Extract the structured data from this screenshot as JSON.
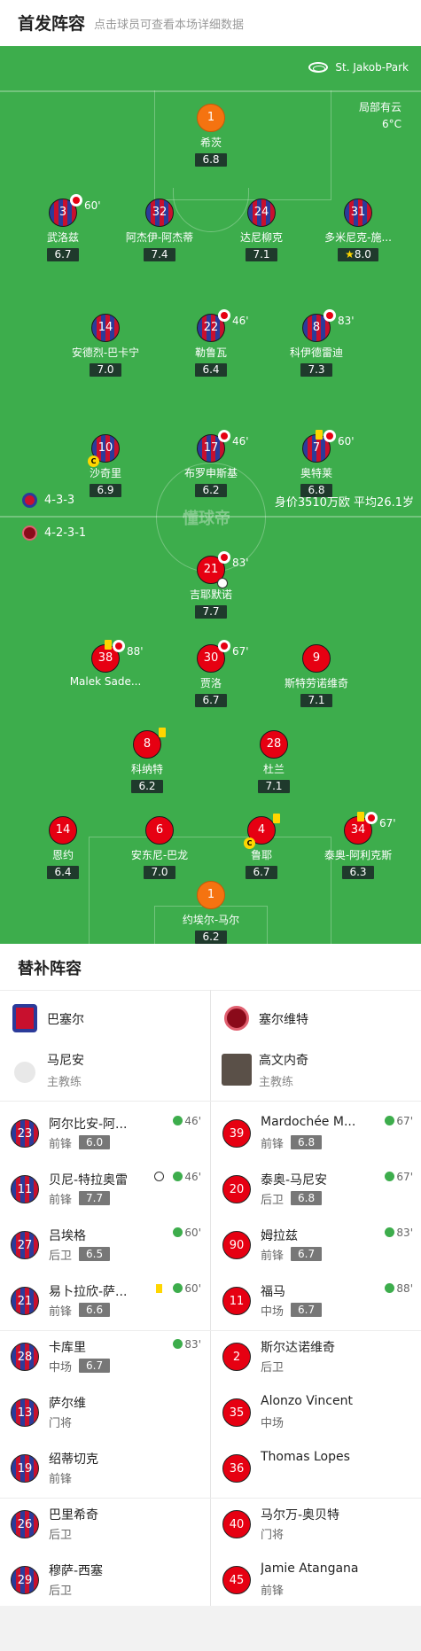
{
  "header": {
    "title": "首发阵容",
    "subtitle": "点击球员可查看本场详细数据"
  },
  "venue": {
    "name": "St. Jakob-Park",
    "icon": "stadium-icon"
  },
  "weather": {
    "condition": "局部有云",
    "temp": "6°C"
  },
  "watermark": "懂球帝",
  "home": {
    "formation": "4-3-3",
    "club": "巴塞尔",
    "coach": "马尼安",
    "coach_role": "主教练",
    "color": "#2b3b9a"
  },
  "away": {
    "formation": "4-2-3-1",
    "club": "塞尔维特",
    "coach": "高文内奇",
    "coach_role": "主教练",
    "color": "#e60012"
  },
  "market_value": "身价3510万欧 平均26.1岁",
  "home_players": [
    {
      "num": "1",
      "name": "希茨",
      "rating": "6.8",
      "gk": true
    },
    {
      "num": "3",
      "name": "武洛兹",
      "rating": "6.7",
      "sub": "60'"
    },
    {
      "num": "32",
      "name": "阿杰伊-阿杰蒂",
      "rating": "7.4"
    },
    {
      "num": "24",
      "name": "达尼柳克",
      "rating": "7.1"
    },
    {
      "num": "31",
      "name": "多米尼克-施...",
      "rating": "8.0",
      "star": true
    },
    {
      "num": "14",
      "name": "安德烈-巴卡宁",
      "rating": "7.0"
    },
    {
      "num": "22",
      "name": "勒鲁瓦",
      "rating": "6.4",
      "sub": "46'"
    },
    {
      "num": "8",
      "name": "科伊德雷迪",
      "rating": "7.3",
      "sub": "83'"
    },
    {
      "num": "10",
      "name": "沙奇里",
      "rating": "6.9",
      "captain": "C"
    },
    {
      "num": "17",
      "name": "布罗申斯基",
      "rating": "6.2",
      "sub": "46'"
    },
    {
      "num": "7",
      "name": "奥特莱",
      "rating": "6.8",
      "sub": "60'",
      "yellow": true
    }
  ],
  "away_players": [
    {
      "num": "21",
      "name": "吉耶默诺",
      "rating": "7.7",
      "sub": "83'",
      "goal": true
    },
    {
      "num": "38",
      "name": "Malek Sade...",
      "rating": "",
      "sub": "88'",
      "yellow": true
    },
    {
      "num": "30",
      "name": "贾洛",
      "rating": "6.7",
      "sub": "67'"
    },
    {
      "num": "9",
      "name": "斯特劳诺维奇",
      "rating": "7.1"
    },
    {
      "num": "8",
      "name": "科纳特",
      "rating": "6.2",
      "yellow": true
    },
    {
      "num": "28",
      "name": "杜兰",
      "rating": "7.1"
    },
    {
      "num": "14",
      "name": "恩约",
      "rating": "6.4"
    },
    {
      "num": "6",
      "name": "安东尼-巴龙",
      "rating": "7.0"
    },
    {
      "num": "4",
      "name": "鲁耶",
      "rating": "6.7",
      "captain": "C",
      "yellow": true
    },
    {
      "num": "34",
      "name": "泰奥-阿利克斯",
      "rating": "6.3",
      "sub": "67'",
      "yellow": true
    },
    {
      "num": "1",
      "name": "约埃尔-马尔",
      "rating": "6.2",
      "gk": true
    }
  ],
  "subs_title": "替补阵容",
  "home_subs": [
    {
      "num": "23",
      "name": "阿尔比安-阿...",
      "pos": "前锋",
      "rating": "6.0",
      "min": "46'"
    },
    {
      "num": "11",
      "name": "贝尼-特拉奥雷",
      "pos": "前锋",
      "rating": "7.7",
      "min": "46'",
      "goal": true
    },
    {
      "num": "27",
      "name": "吕埃格",
      "pos": "后卫",
      "rating": "6.5",
      "min": "60'"
    },
    {
      "num": "21",
      "name": "易卜拉欣-萨...",
      "pos": "前锋",
      "rating": "6.6",
      "min": "60'",
      "yellow": true
    },
    {
      "num": "28",
      "name": "卡库里",
      "pos": "中场",
      "rating": "6.7",
      "min": "83'"
    },
    {
      "num": "13",
      "name": "萨尔维",
      "pos": "门将"
    },
    {
      "num": "19",
      "name": "绍蒂切克",
      "pos": "前锋"
    },
    {
      "num": "26",
      "name": "巴里希奇",
      "pos": "后卫"
    },
    {
      "num": "29",
      "name": "穆萨-西塞",
      "pos": "后卫"
    }
  ],
  "away_subs": [
    {
      "num": "39",
      "name": "Mardochée M...",
      "pos": "前锋",
      "rating": "6.8",
      "min": "67'"
    },
    {
      "num": "20",
      "name": "泰奥-马尼安",
      "pos": "后卫",
      "rating": "6.8",
      "min": "67'"
    },
    {
      "num": "90",
      "name": "姆拉兹",
      "pos": "前锋",
      "rating": "6.7",
      "min": "83'"
    },
    {
      "num": "11",
      "name": "福马",
      "pos": "中场",
      "rating": "6.7",
      "min": "88'"
    },
    {
      "num": "2",
      "name": "斯尔达诺维奇",
      "pos": "后卫"
    },
    {
      "num": "35",
      "name": "Alonzo Vincent",
      "pos": "中场"
    },
    {
      "num": "36",
      "name": "Thomas Lopes",
      "pos": ""
    },
    {
      "num": "40",
      "name": "马尔万-奥贝特",
      "pos": "门将"
    },
    {
      "num": "45",
      "name": "Jamie Atangana",
      "pos": "前锋"
    }
  ]
}
